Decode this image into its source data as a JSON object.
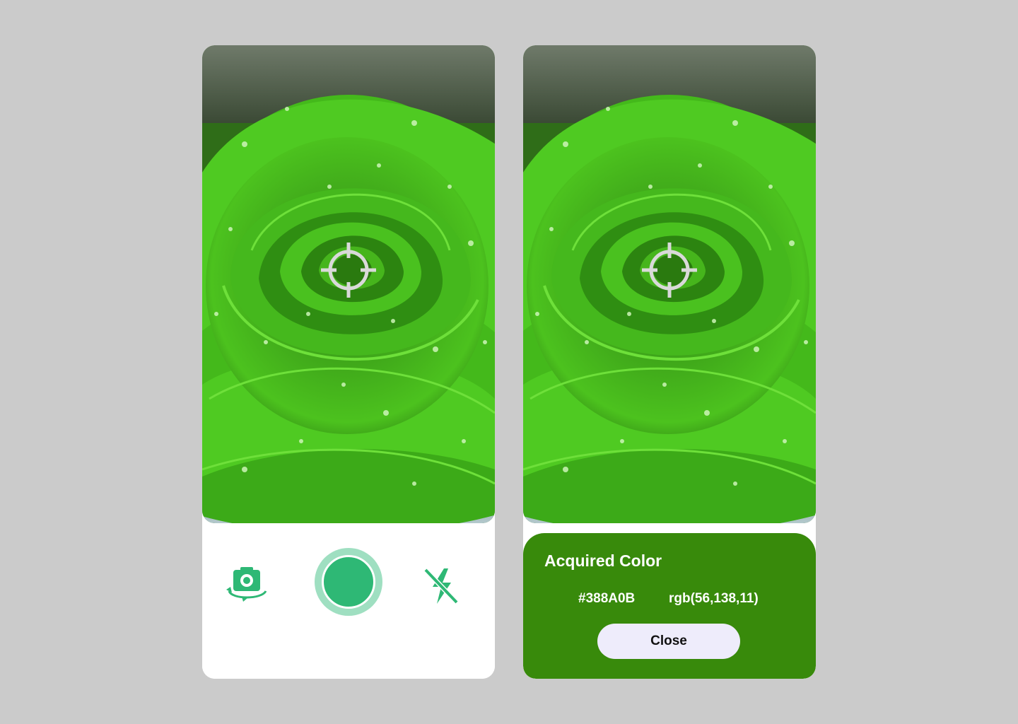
{
  "camera_screen": {
    "viewfinder": {
      "subject": "green rose with water droplets",
      "crosshair_icon": "crosshair-icon"
    },
    "controls": {
      "flip_camera_icon": "flip-camera-icon",
      "shutter_icon": "shutter-button",
      "flash_off_icon": "flash-off-icon"
    }
  },
  "result_screen": {
    "sheet": {
      "title": "Acquired Color",
      "hex": "#388A0B",
      "rgb": "rgb(56,138,11)",
      "close_label": "Close",
      "background_color": "#388A0B"
    }
  },
  "colors": {
    "page_background": "#CBCBCB",
    "accent": "#2EB875",
    "accent_light": "#9FDFC1",
    "close_button_bg": "#EEECFB"
  }
}
